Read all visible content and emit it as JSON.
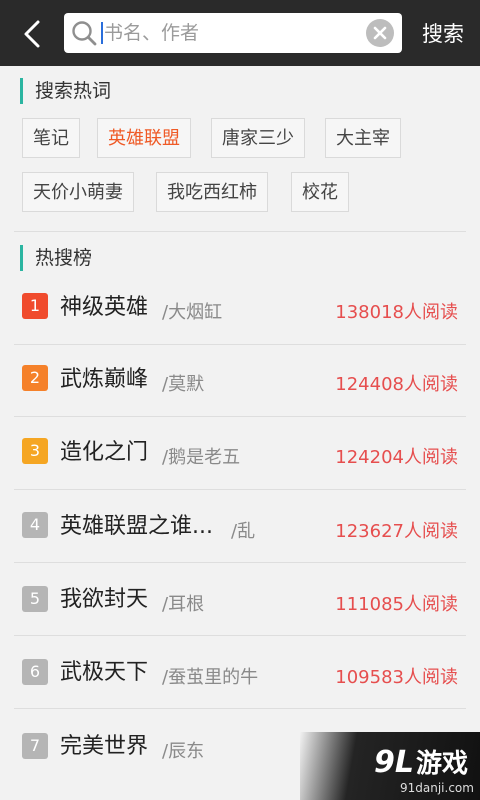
{
  "search": {
    "placeholder": "书名、作者",
    "button_label": "搜索"
  },
  "hot_words": {
    "title": "搜索热词",
    "items": [
      {
        "label": "笔记",
        "highlighted": false
      },
      {
        "label": "英雄联盟",
        "highlighted": true
      },
      {
        "label": "唐家三少",
        "highlighted": false
      },
      {
        "label": "大主宰",
        "highlighted": false
      },
      {
        "label": "天价小萌妻",
        "highlighted": false
      },
      {
        "label": "我吃西红柿",
        "highlighted": false
      },
      {
        "label": "校花",
        "highlighted": false
      }
    ]
  },
  "hot_list": {
    "title": "热搜榜",
    "items": [
      {
        "rank": "1",
        "title": "神级英雄",
        "author": "/大烟缸",
        "reads": "138018人阅读",
        "badge_color": "#f04b2d"
      },
      {
        "rank": "2",
        "title": "武炼巅峰",
        "author": "/莫默",
        "reads": "124408人阅读",
        "badge_color": "#f5812a"
      },
      {
        "rank": "3",
        "title": "造化之门",
        "author": "/鹅是老五",
        "reads": "124204人阅读",
        "badge_color": "#f5a623"
      },
      {
        "rank": "4",
        "title": "英雄联盟之谁...",
        "author": "/乱",
        "reads": "123627人阅读",
        "badge_color": "#b5b5b5"
      },
      {
        "rank": "5",
        "title": "我欲封天",
        "author": "/耳根",
        "reads": "111085人阅读",
        "badge_color": "#b5b5b5"
      },
      {
        "rank": "6",
        "title": "武极天下",
        "author": "/蚕茧里的牛",
        "reads": "109583人阅读",
        "badge_color": "#b5b5b5"
      },
      {
        "rank": "7",
        "title": "完美世界",
        "author": "/辰东",
        "reads": "",
        "badge_color": "#b5b5b5"
      }
    ]
  },
  "watermark": {
    "logo_text": "9L游戏",
    "site_text": "91danji.com"
  },
  "colors": {
    "topbar": "#2a2a2a",
    "accent_teal": "#2bb5a1",
    "hot_orange": "#ef5a26",
    "reads_red": "#e64e4e"
  }
}
